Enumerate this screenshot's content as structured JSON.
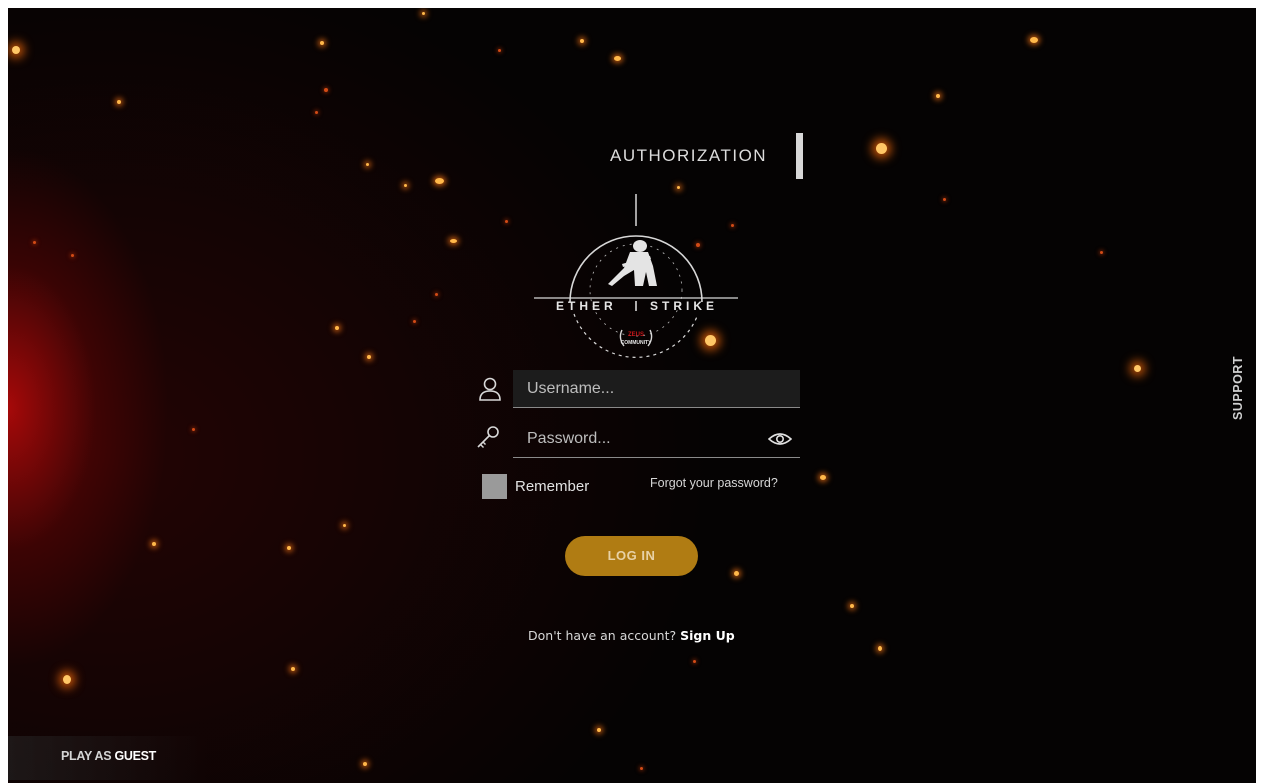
{
  "header": {
    "title": "AUTHORIZATION"
  },
  "logo": {
    "word_left": "ETHER",
    "word_right": "STRIKE",
    "badge_top": "ZEUS",
    "badge_bottom": "COMMUNITY"
  },
  "form": {
    "username_placeholder": "Username...",
    "username_value": "",
    "password_placeholder": "Password...",
    "password_value": "",
    "remember_label": "Remember",
    "remember_checked": false,
    "forgot_label": "Forgot your password?",
    "login_label": "LOG IN"
  },
  "signup": {
    "prompt": "Don't have an account?",
    "link": "Sign Up"
  },
  "support": {
    "label": "SUPPORT"
  },
  "guest": {
    "prefix": "PLAY AS",
    "strong": "GUEST"
  },
  "colors": {
    "background": "#050303",
    "accent_gold": "#b07c13",
    "ember": "#ffb84a",
    "text": "#dcdcdc"
  },
  "icons": {
    "username": "user-icon",
    "password": "key-icon",
    "show_password": "eye-icon"
  }
}
